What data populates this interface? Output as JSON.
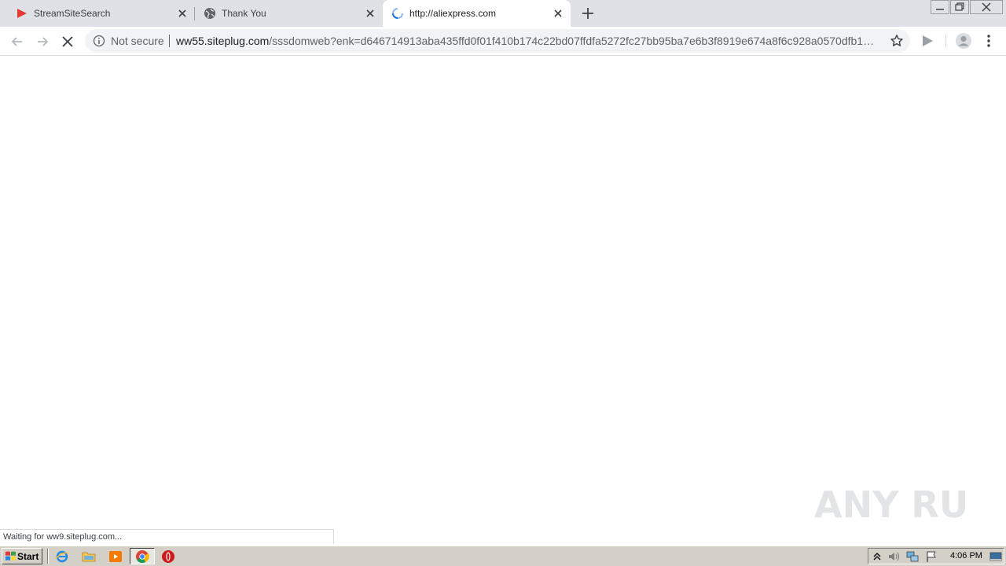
{
  "browser": {
    "tabs": [
      {
        "title": "StreamSiteSearch",
        "active": false
      },
      {
        "title": "Thank You",
        "active": false
      },
      {
        "title": "http://aliexpress.com",
        "active": true,
        "loading": true
      }
    ],
    "security_label": "Not secure",
    "url_host": "ww55.siteplug.com",
    "url_path": "/sssdomweb?enk=d646714913aba435ffd0f01f410b174c22bd07ffdfa5272fc27bb95ba7e6b3f8919e674a8f6c928a0570dfb1…",
    "status_text": "Waiting for ww9.siteplug.com...",
    "accent_color": "#1a73e8"
  },
  "watermark": {
    "text": "ANY RUN"
  },
  "taskbar": {
    "start_label": "Start",
    "clock": "4:06 PM",
    "quick_launch": [
      "ie-icon",
      "folder-icon",
      "media-player-icon",
      "chrome-icon",
      "opera-icon"
    ],
    "tray_icons": [
      "tray-expand-icon",
      "volume-icon",
      "network-icon",
      "flag-icon",
      "show-desktop-icon"
    ]
  }
}
